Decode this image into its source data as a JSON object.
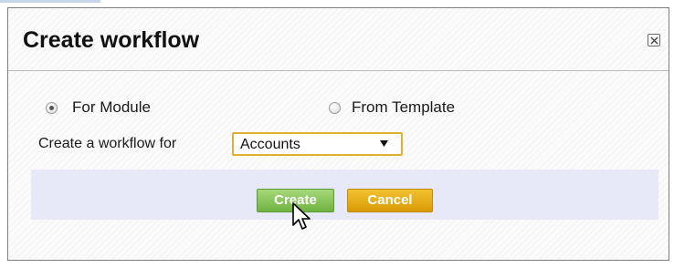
{
  "dialog": {
    "title": "Create workflow",
    "close_icon": "close-icon"
  },
  "options": {
    "for_module_label": "For Module",
    "for_module_checked": true,
    "from_template_label": "From Template",
    "from_template_checked": false
  },
  "form": {
    "workflow_for_label": "Create a workflow for",
    "module_select_value": "Accounts"
  },
  "actions": {
    "create_label": "Create",
    "cancel_label": "Cancel"
  },
  "colors": {
    "create_button": "#7dbb4f",
    "cancel_button": "#e5a915",
    "action_bar": "#e7e9f8",
    "select_border": "#e0b030"
  }
}
